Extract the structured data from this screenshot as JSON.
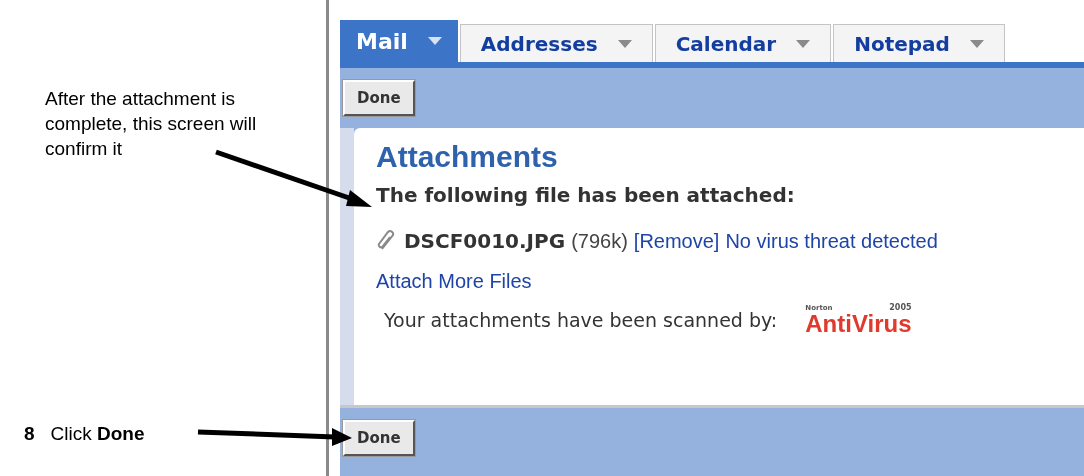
{
  "callouts": [
    {
      "text": "After the attachment is complete, this screen will confirm it"
    }
  ],
  "step": {
    "number": "8",
    "text": "Click **Done**"
  },
  "tabs": [
    {
      "label": "Mail",
      "selected": true
    },
    {
      "label": "Addresses",
      "selected": false
    },
    {
      "label": "Calendar",
      "selected": false
    },
    {
      "label": "Notepad",
      "selected": false
    }
  ],
  "top_button": "Done",
  "panel": {
    "title": "Attachments",
    "message": "The following file has been attached:",
    "file": {
      "name": "DSCF0010.JPG",
      "size": "(796k)",
      "remove": "[Remove]",
      "status": "No virus threat detected"
    },
    "attach_more": "Attach More Files",
    "scan_note": "Your attachments have been scanned by:",
    "logo": {
      "brand": "Norton",
      "name": "AntiVirus",
      "year": "2005"
    }
  },
  "bottom_button": "Done"
}
